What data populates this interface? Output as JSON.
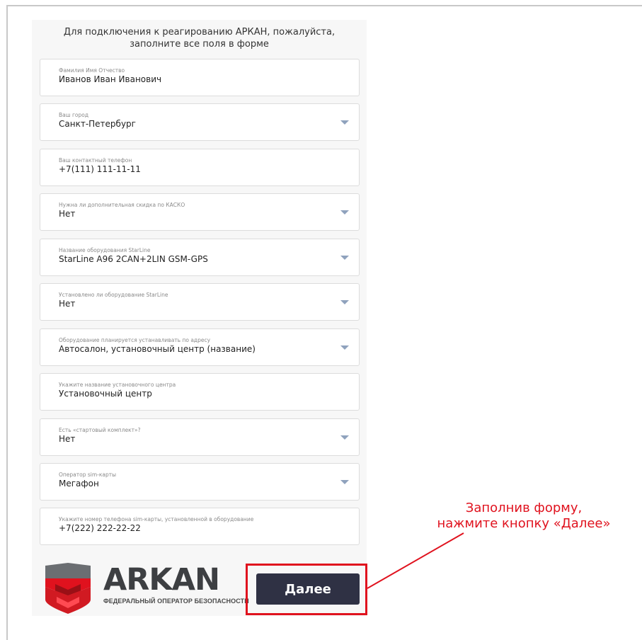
{
  "intro": {
    "line1": "Для подключения к реагированию АРКАН, пожалуйста,",
    "line2": "заполните все поля в форме"
  },
  "fields": [
    {
      "label": "Фамилия Имя Отчество",
      "value": "Иванов Иван Иванович",
      "type": "text"
    },
    {
      "label": "Ваш город",
      "value": "Санкт-Петербург",
      "type": "select"
    },
    {
      "label": "Ваш контактный телефон",
      "value": "+7(111) 111-11-11",
      "type": "text"
    },
    {
      "label": "Нужна ли дополнительная скидка по КАСКО",
      "value": "Нет",
      "type": "select"
    },
    {
      "label": "Название оборудования StarLine",
      "value": "StarLine A96 2CAN+2LIN GSM-GPS",
      "type": "select"
    },
    {
      "label": "Установлено ли оборудование StarLine",
      "value": "Нет",
      "type": "select"
    },
    {
      "label": "Оборудование планируется устанавливать по адресу",
      "value": "Автосалон, установочный центр (название)",
      "type": "select"
    },
    {
      "label": "Укажите название установочного центра",
      "value": "Установочный центр",
      "type": "text"
    },
    {
      "label": "Есть «стартовый комплект»?",
      "value": "Нет",
      "type": "select"
    },
    {
      "label": "Оператор sim-карты",
      "value": "Мегафон",
      "type": "select"
    },
    {
      "label": "Укажите номер телефона sim-карты, установленной в оборудование",
      "value": "+7(222) 222-22-22",
      "type": "text"
    }
  ],
  "logo": {
    "name": "ARKAN",
    "tagline": "ФЕДЕРАЛЬНЫЙ ОПЕРАТОР БЕЗОПАСНОСТИ"
  },
  "next_button": {
    "label": "Далее"
  },
  "callout": {
    "line1": "Заполнив форму,",
    "line2": "нажмите кнопку «Далее»"
  },
  "colors": {
    "accent_red": "#e0121e",
    "button_bg": "#2f3144",
    "caret": "#8fa2bd"
  },
  "icons": {
    "dropdown": "chevron-down-icon",
    "logo": "arkan-shield-logo",
    "annotation": "arrow-line"
  }
}
